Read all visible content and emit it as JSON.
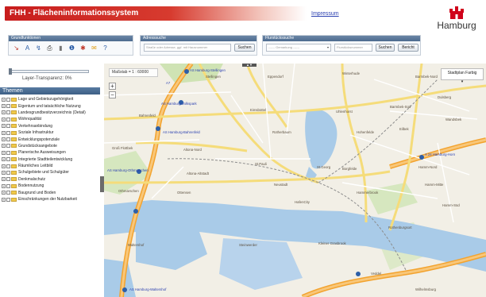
{
  "header": {
    "title": "FHH - Flächeninformationssystem",
    "impressum": "Impressum",
    "logo_text": "Hamburg"
  },
  "panels": {
    "grundfunktionen": {
      "title": "Grundfunktionen"
    },
    "adresssuche": {
      "title": "Adresssuche",
      "placeholder": "Straße oder Adresse, ggf. mit Hausnummer",
      "search_label": "Suchen"
    },
    "flurstueckssuche": {
      "title": "Flurstückssuche",
      "gemarkung_placeholder": "------ Gemarkung ------",
      "flurstueck_placeholder": "Flurstücksnummer",
      "search_label": "Suchen",
      "report_label": "Bericht"
    }
  },
  "tools": [
    {
      "icon": "measure-line-icon",
      "glyph": "↘",
      "color": "#c0392b"
    },
    {
      "icon": "text-annotation-icon",
      "glyph": "A",
      "color": "#2d5fa8"
    },
    {
      "icon": "freehand-draw-icon",
      "glyph": "↯",
      "color": "#2d5fa8"
    },
    {
      "icon": "print-icon",
      "glyph": "⎙",
      "color": "#333333"
    },
    {
      "icon": "ruler-icon",
      "glyph": "▮",
      "color": "#777777"
    },
    {
      "icon": "info-icon",
      "glyph": "❶",
      "color": "#2d5fa8"
    },
    {
      "icon": "marker-pin-icon",
      "glyph": "✱",
      "color": "#c0392b"
    },
    {
      "icon": "mail-icon",
      "glyph": "✉",
      "color": "#e1a11d"
    },
    {
      "icon": "help-icon",
      "glyph": "?",
      "color": "#2d5fa8"
    }
  ],
  "sidebar": {
    "transparency_label": "Layer-Transparenz: 0%",
    "themen_title": "Themen",
    "layers": [
      "Lage und Gebietszugehörigkeit",
      "Eigentum und tatsächliche Nutzung",
      "Landesgrundbesitzverzeichnis (Detail)",
      "Wohnqualität",
      "Verkehrsanbindung",
      "Soziale Infrastruktur",
      "Entwicklungspotenziale",
      "Grundstücksangebote",
      "Planerische Ausweisungen",
      "Integrierte Stadtteilentwicklung",
      "Räumliches Leitbild",
      "Schulgebiete und Schulgüter",
      "Denkmalschutz",
      "Bodennutzung",
      "Baugrund und Boden",
      "Einschränkungen der Nutzbarkeit"
    ]
  },
  "map": {
    "scale_label": "Maßstab = 1 : 60000",
    "basemap_label": "Stadtplan Farbig",
    "top_tab": "▲▼",
    "zoom_in": "+",
    "zoom_out": "−",
    "labels": [
      "Stellingen",
      "Eppendorf",
      "Winterhude",
      "Barmbek-Nord",
      "Bahrenfeld",
      "Eimsbüttel",
      "Uhlenhorst",
      "Barmbek-Süd",
      "Dulsberg",
      "Rotherbaum",
      "Eilbek",
      "Wandsbek",
      "Hohenfelde",
      "Altona-Nord",
      "St.Georg",
      "Hamm-Nord",
      "Groß Flottbek",
      "Othmarschen",
      "St.Pauli",
      "Borgfelde",
      "Hamm-Mitte",
      "Altona-Altstadt",
      "Neustadt",
      "Hammerbrook",
      "Ottensen",
      "Hamm-Süd",
      "HafenCity",
      "Rothenburgsort",
      "Waltershof",
      "Steinwerder",
      "Kleiner Grasbrook",
      "Veddel",
      "Wilhelmsburg"
    ],
    "road_labels": [
      "A7",
      "A 24 Hamburg-Horn",
      "AS Hamburg-Volkspark",
      "AS Hamburg-Bahrenfeld",
      "AS Hamburg-Othmarschen",
      "AS Hamburg-Waltershof",
      "AS Hamburg-Stellingen"
    ]
  }
}
